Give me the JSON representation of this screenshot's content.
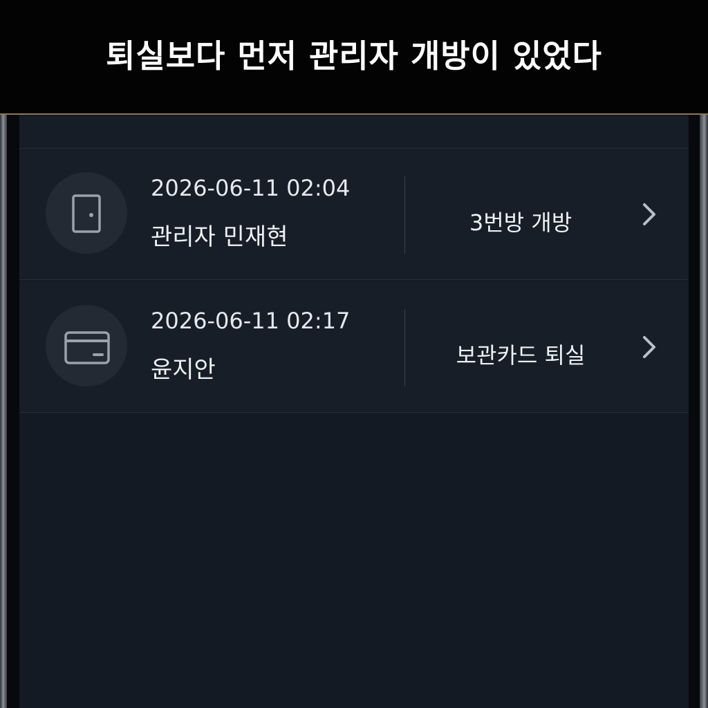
{
  "caption": {
    "text": "퇴실보다 먼저 관리자 개방이 있었다"
  },
  "log": {
    "entries": [
      {
        "timestamp": "2026-06-11 02:04",
        "actor": "관리자 민재현",
        "action": "3번방 개방",
        "icon": "door-icon"
      },
      {
        "timestamp": "2026-06-11 02:17",
        "actor": "윤지안",
        "action": "보관카드 퇴실",
        "icon": "card-icon"
      }
    ]
  },
  "colors": {
    "caption_background": "#030303",
    "caption_text": "#ffffff",
    "caption_border": "#8d7a55",
    "screen_background": "#141a23",
    "row_background": "#171e28",
    "icon_circle": "#232a33",
    "icon_stroke": "#9aa3ad",
    "text_primary": "#eef0f3"
  }
}
